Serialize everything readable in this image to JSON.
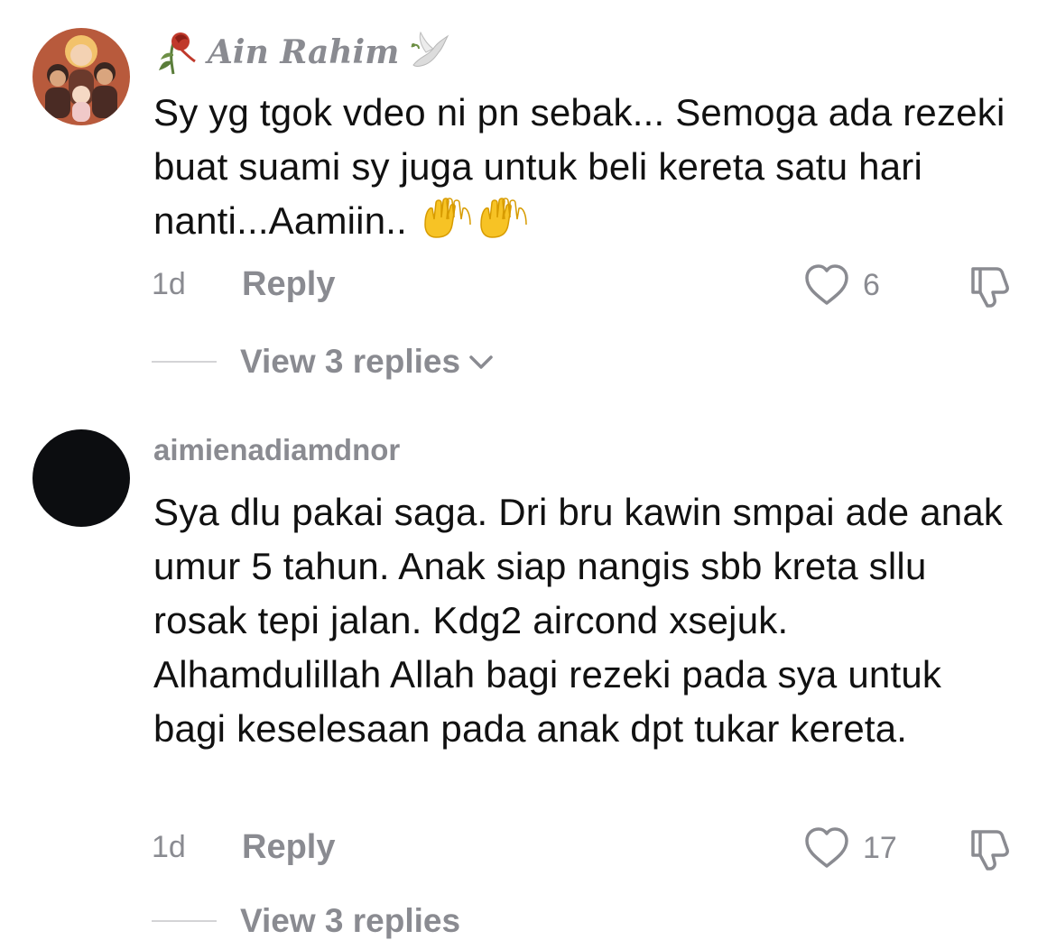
{
  "comments": [
    {
      "username": "Ain Rahim",
      "text": "Sy yg tgok vdeo ni pn sebak... Semoga ada rezeki buat suami sy juga untuk beli kereta satu hari nanti...Aamiin..",
      "emoji": "raised-hands-emoji",
      "age": "1d",
      "reply_label": "Reply",
      "likes": "6",
      "view_replies": "View 3 replies"
    },
    {
      "username": "aimienadiamdnor",
      "text": "Sya dlu pakai saga. Dri bru kawin smpai ade anak umur 5 tahun. Anak siap nangis sbb kreta sllu rosak tepi jalan. Kdg2 aircond xsejuk. Alhamdulillah Allah bagi rezeki pada sya untuk bagi keselesaan pada anak dpt tukar kereta.",
      "age": "1d",
      "reply_label": "Reply",
      "likes": "17",
      "view_replies": "View 3 replies"
    }
  ],
  "colors": {
    "text": "#111111",
    "muted": "#8a8b91",
    "divider": "#d4d4d6"
  },
  "icons": [
    "heart-icon",
    "dislike-icon",
    "chevron-down-icon",
    "rose-icon",
    "dove-icon"
  ]
}
